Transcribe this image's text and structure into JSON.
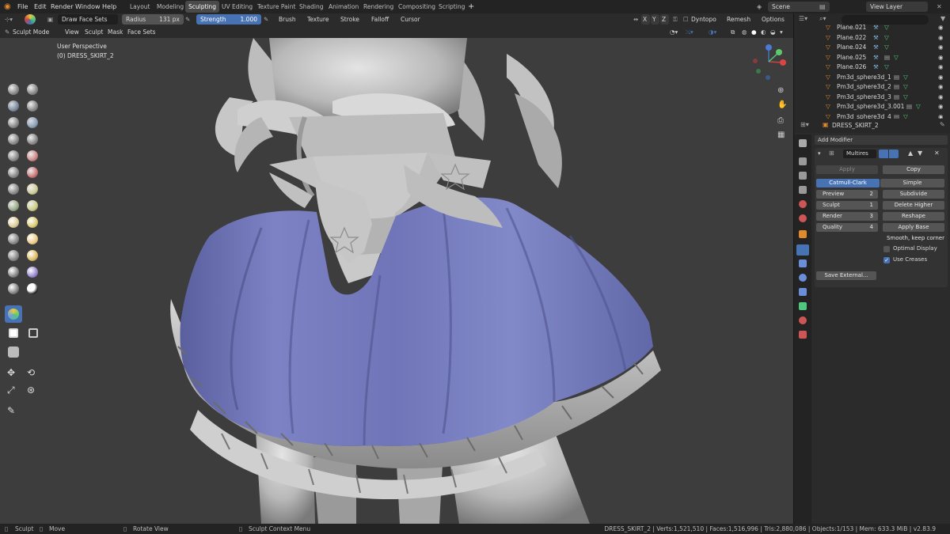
{
  "menu": {
    "items": [
      "File",
      "Edit",
      "Render",
      "Window",
      "Help"
    ]
  },
  "workspaces": {
    "tabs": [
      "Layout",
      "Modeling",
      "Sculpting",
      "UV Editing",
      "Texture Paint",
      "Shading",
      "Animation",
      "Rendering",
      "Compositing",
      "Scripting"
    ],
    "active": "Sculpting"
  },
  "scene": {
    "name": "Scene",
    "view_layer": "View Layer"
  },
  "tool_header": {
    "brush_name": "Draw Face Sets",
    "radius_label": "Radius",
    "radius_value": "131 px",
    "strength_label": "Strength",
    "strength_value": "1.000",
    "brush_menu": "Brush",
    "texture_menu": "Texture",
    "stroke_menu": "Stroke",
    "falloff_menu": "Falloff",
    "cursor_menu": "Cursor",
    "axes": [
      "X",
      "Y",
      "Z"
    ],
    "dyntopo": "Dyntopo",
    "remesh": "Remesh",
    "options": "Options"
  },
  "view_header": {
    "mode": "Sculpt Mode",
    "menus": [
      "View",
      "Sculpt",
      "Mask",
      "Face Sets"
    ]
  },
  "viewport": {
    "perspective": "User Perspective",
    "object": "(0) DRESS_SKIRT_2"
  },
  "outliner": {
    "search_placeholder": "",
    "rows": [
      "Plane.021",
      "Plane.022",
      "Plane.024",
      "Plane.025",
      "Plane.026",
      "Pm3d_sphere3d_1",
      "Pm3d_sphere3d_2",
      "Pm3d_sphere3d_3",
      "Pm3d_sphere3d_3.001",
      "Pm3d_sphere3d_4"
    ]
  },
  "properties": {
    "object_name": "DRESS_SKIRT_2",
    "add_modifier": "Add Modifier",
    "modifier_name": "Multires",
    "apply": "Apply",
    "copy": "Copy",
    "catmull_clark": "Catmull-Clark",
    "simple": "Simple",
    "levels": [
      {
        "label": "Preview",
        "value": "2"
      },
      {
        "label": "Sculpt",
        "value": "1"
      },
      {
        "label": "Render",
        "value": "3"
      },
      {
        "label": "Quality",
        "value": "4"
      }
    ],
    "right_buttons": [
      "Subdivide",
      "Delete Higher",
      "Reshape",
      "Apply Base"
    ],
    "uv_smooth": "Smooth, keep corner",
    "optimal_display": "Optimal Display",
    "use_creases": "Use Creases",
    "save_external": "Save External..."
  },
  "statusbar": {
    "left": [
      {
        "icon": "mouse-left-icon",
        "label": "Sculpt"
      },
      {
        "icon": "mouse-move-icon",
        "label": "Move"
      },
      {
        "icon": "mouse-middle-icon",
        "label": "Rotate View"
      },
      {
        "icon": "mouse-right-icon",
        "label": "Sculpt Context Menu"
      }
    ],
    "stats": "DRESS_SKIRT_2 | Verts:1,521,510 | Faces:1,516,996 | Tris:2,880,086 | Objects:1/153 | Mem: 633.3 MiB | v2.83.9"
  },
  "colors": {
    "accent": "#4772b3",
    "skirt": "#7f85c4",
    "outliner_icon": "#e08a2c",
    "mesh_green": "#4fc77c"
  }
}
